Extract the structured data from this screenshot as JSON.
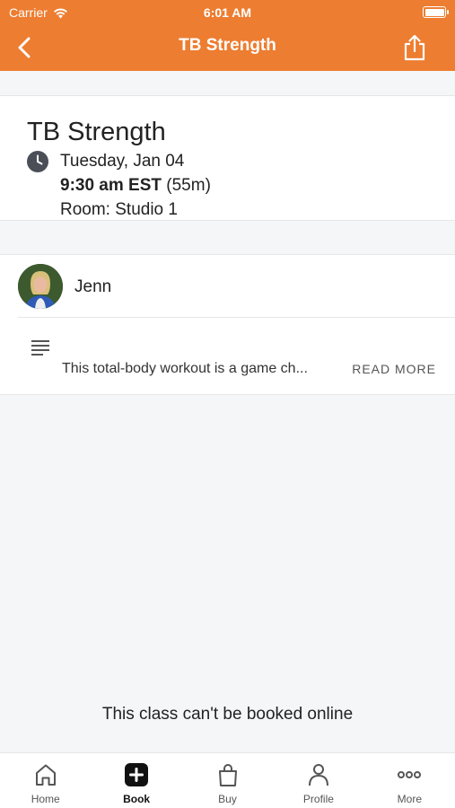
{
  "status_bar": {
    "carrier": "Carrier",
    "time": "6:01 AM"
  },
  "nav": {
    "title": "TB Strength"
  },
  "class_info": {
    "name": "TB Strength",
    "date": "Tuesday, Jan 04",
    "time": "9:30 am EST",
    "duration": "(55m)",
    "room": "Room: Studio 1"
  },
  "staff": {
    "name": "Jenn"
  },
  "description": {
    "text": "This total-body workout is a game ch...",
    "read_more": "READ MORE"
  },
  "booking_note": "This class can't be booked online",
  "tabs": [
    {
      "label": "Home",
      "icon": "home-icon"
    },
    {
      "label": "Book",
      "icon": "plus-square-icon",
      "active": true
    },
    {
      "label": "Buy",
      "icon": "shopping-bag-icon"
    },
    {
      "label": "Profile",
      "icon": "person-icon"
    },
    {
      "label": "More",
      "icon": "more-dots-icon"
    }
  ],
  "colors": {
    "accent": "#ed7d31",
    "background": "#f5f6f8",
    "card": "#ffffff"
  }
}
